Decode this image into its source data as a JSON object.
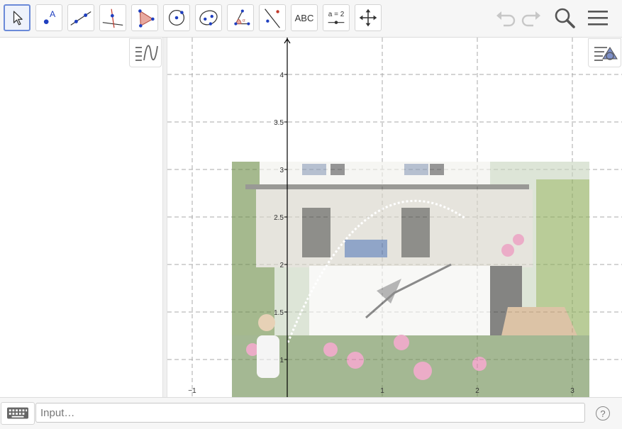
{
  "toolbar": {
    "text_tool_label": "ABC",
    "slider_tool_label": "a = 2"
  },
  "input_bar": {
    "placeholder": "Input…",
    "help_label": "?"
  },
  "graphics": {
    "x_ticks": [
      "−1",
      "1",
      "2",
      "3"
    ],
    "y_ticks": [
      "4",
      "3.5",
      "3",
      "2.5",
      "2",
      "1.5",
      "1"
    ],
    "photo_caption": "garden photo: house with terrace, staircase, roses and a boy spraying a water arc"
  },
  "icons": {
    "move": "move-arrow-icon",
    "point": "point-icon",
    "line": "line-icon",
    "perpendicular": "perpendicular-line-icon",
    "polygon": "polygon-icon",
    "circle": "circle-icon",
    "ellipse": "ellipse-icon",
    "angle": "angle-icon",
    "reflect": "reflect-icon",
    "move_view": "move-graphics-view-icon",
    "undo": "undo-icon",
    "redo": "redo-icon",
    "search": "search-icon",
    "menu": "hamburger-menu-icon",
    "algebra_toggle": "algebra-view-toggle-icon",
    "style_toggle": "style-bar-toggle-icon",
    "keyboard": "keyboard-icon",
    "help": "help-icon"
  },
  "colors": {
    "active_tool_border": "#6b8ad8",
    "point_blue": "#1f3fbf",
    "axis": "#000000",
    "grid": "#a0a0a0"
  }
}
